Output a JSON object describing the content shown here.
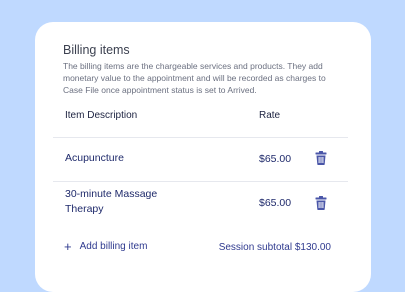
{
  "billing": {
    "title": "Billing items",
    "description": "The billing items are the chargeable services and products. They add monetary value to the appointment and will be recorded as charges to Case File once appointment status is set to Arrived.",
    "columns": {
      "item": "Item Description",
      "rate": "Rate"
    },
    "items": [
      {
        "name": "Acupuncture",
        "rate": "$65.00"
      },
      {
        "name": "30-minute Massage Therapy",
        "rate": "$65.00"
      }
    ],
    "add_label": "Add billing item",
    "add_icon": "+",
    "subtotal": "Session subtotal $130.00"
  },
  "colors": {
    "background": "#bfd9ff",
    "accent": "#2f3a8f",
    "trash_icon": "#4a56a8"
  },
  "icons": {
    "delete": "trash-icon",
    "add": "plus-icon"
  }
}
